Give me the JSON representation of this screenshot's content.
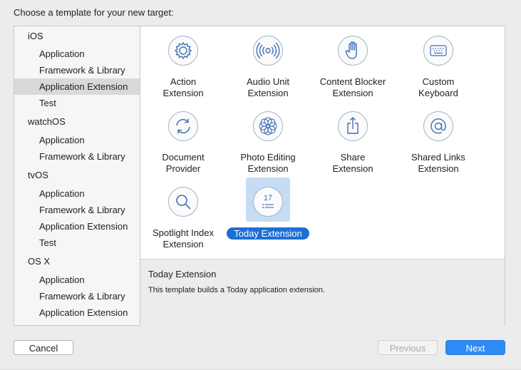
{
  "header": {
    "title": "Choose a template for your new target:"
  },
  "sidebar": {
    "groups": [
      {
        "name": "iOS",
        "items": [
          "Application",
          "Framework & Library",
          "Application Extension",
          "Test"
        ]
      },
      {
        "name": "watchOS",
        "items": [
          "Application",
          "Framework & Library"
        ]
      },
      {
        "name": "tvOS",
        "items": [
          "Application",
          "Framework & Library",
          "Application Extension",
          "Test"
        ]
      },
      {
        "name": "OS X",
        "items": [
          "Application",
          "Framework & Library",
          "Application Extension"
        ]
      }
    ],
    "selected": "iOS / Application Extension"
  },
  "templates": [
    {
      "label": "Action Extension",
      "icon": "gear-icon"
    },
    {
      "label": "Audio Unit Extension",
      "icon": "audio-wave-icon"
    },
    {
      "label": "Content Blocker Extension",
      "icon": "hand-icon"
    },
    {
      "label": "Custom Keyboard",
      "icon": "keyboard-icon"
    },
    {
      "label": "Document Provider",
      "icon": "sync-arrows-icon"
    },
    {
      "label": "Photo Editing Extension",
      "icon": "flower-icon"
    },
    {
      "label": "Share Extension",
      "icon": "share-icon"
    },
    {
      "label": "Shared Links Extension",
      "icon": "at-sign-icon"
    },
    {
      "label": "Spotlight Index Extension",
      "icon": "magnifier-icon"
    },
    {
      "label": "Today Extension",
      "icon": "calendar-list-icon",
      "selected": true,
      "calendar_day": "17"
    }
  ],
  "description": {
    "title": "Today Extension",
    "text": "This template builds a Today application extension."
  },
  "buttons": {
    "cancel": "Cancel",
    "previous": "Previous",
    "next": "Next"
  },
  "colors": {
    "accent": "#2f8af5",
    "selection": "#1d6fd6",
    "icon_stroke": "#3f6fb5"
  }
}
